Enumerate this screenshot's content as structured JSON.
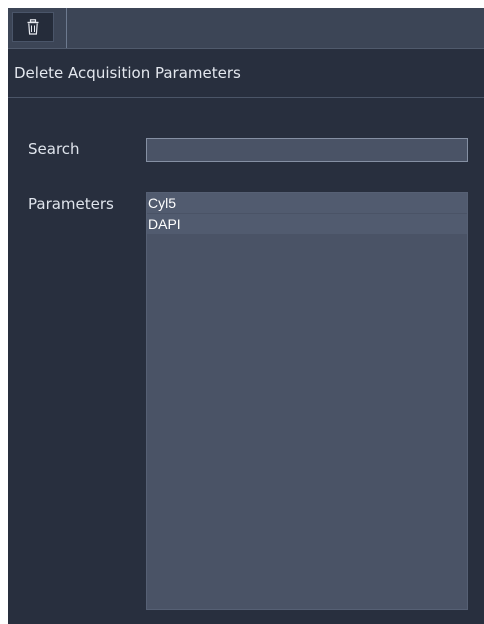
{
  "tabbar": {
    "tabs": [
      {
        "icon": "trash-icon"
      }
    ]
  },
  "panel": {
    "title": "Delete Acquisition Parameters"
  },
  "search": {
    "label": "Search",
    "value": "",
    "placeholder": ""
  },
  "parameters": {
    "label": "Parameters",
    "items": [
      "Cyl5",
      "DAPI"
    ]
  },
  "colors": {
    "background": "#282f3e",
    "tabbar": "#3c4556",
    "field": "#4a5366",
    "text": "#e3e7ee"
  }
}
